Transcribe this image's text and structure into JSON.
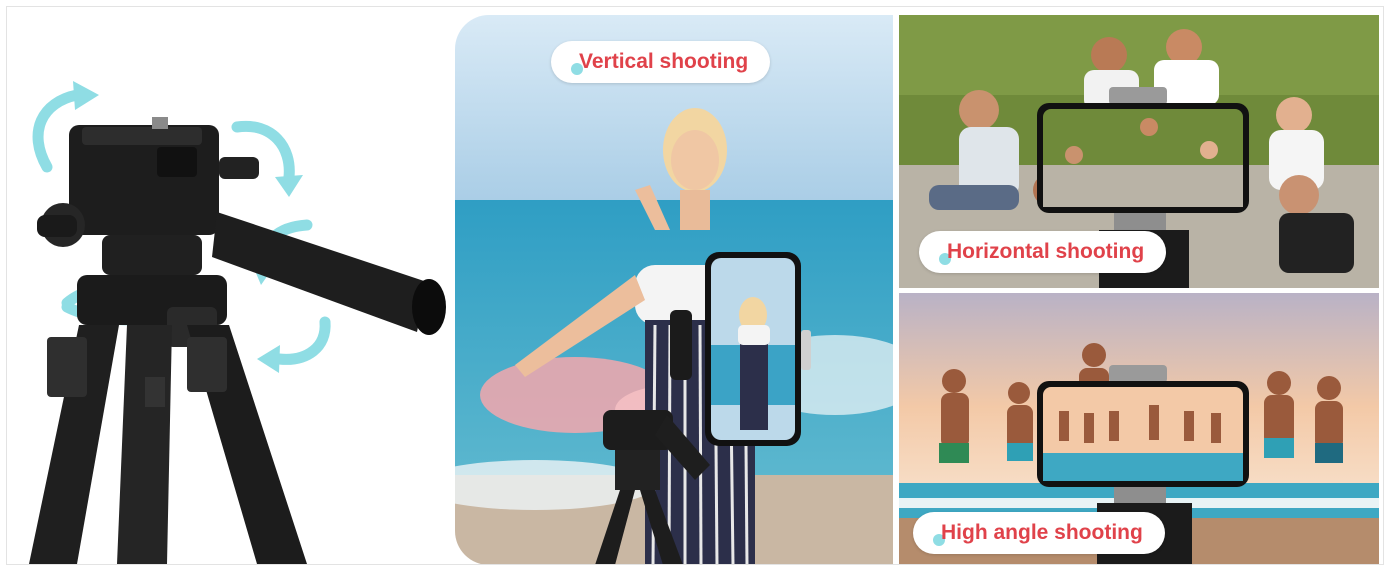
{
  "panels": {
    "vertical": {
      "label": "Vertical shooting"
    },
    "horizontal": {
      "label": "Horizontal shooting"
    },
    "high_angle": {
      "label": "High angle shooting"
    }
  },
  "colors": {
    "label_text": "#e0424a",
    "label_bg": "#ffffff",
    "accent_arrows": "#8fdde4",
    "tripod_body": "#1c1c1c",
    "sea": "#2f9ec4",
    "sky_sunset": "#f3c9a7",
    "grass": "#6f8a3a"
  },
  "icons": [
    "rotate-arrow-icon",
    "smartphone-icon",
    "tripod-icon"
  ]
}
